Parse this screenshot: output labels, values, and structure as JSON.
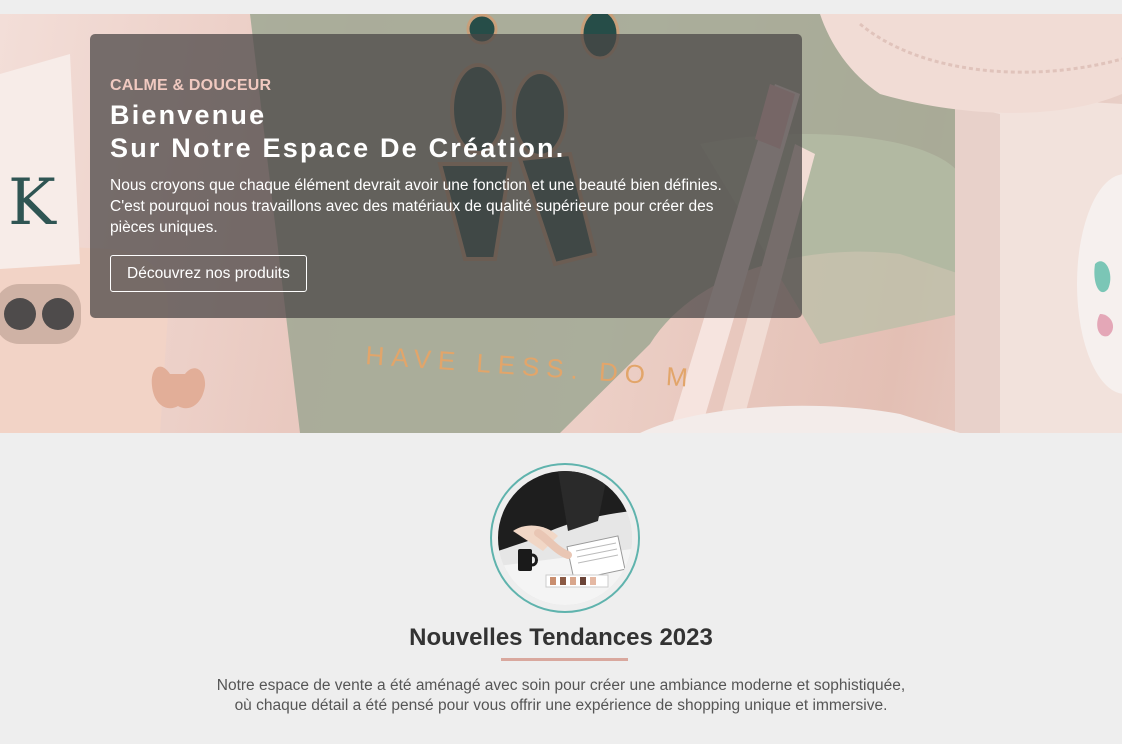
{
  "hero": {
    "eyebrow": "CALME & DOUCEUR",
    "headline_line1": "Bienvenue",
    "headline_line2": "Sur Notre Espace De Création.",
    "description_line1": "Nous croyons que chaque élément devrait avoir une fonction et une beauté bien définies.",
    "description_line2": "C'est pourquoi nous travaillons avec des matériaux de qualité supérieure pour créer des",
    "description_line3": "pièces uniques.",
    "cta_label": "Découvrez nos produits",
    "background_print_text": "HAVE LESS. DO M"
  },
  "trends": {
    "title": "Nouvelles Tendances 2023",
    "text_line1": "Notre espace de vente a été aménagé avec soin pour créer une ambiance moderne et sophistiquée,",
    "text_line2": "où chaque détail a été pensé pour vous offrir une expérience de shopping unique et immersive."
  },
  "colors": {
    "accent_teal": "#5fb3ad",
    "accent_rose": "#d9a89e",
    "overlay": "#4a4646"
  }
}
